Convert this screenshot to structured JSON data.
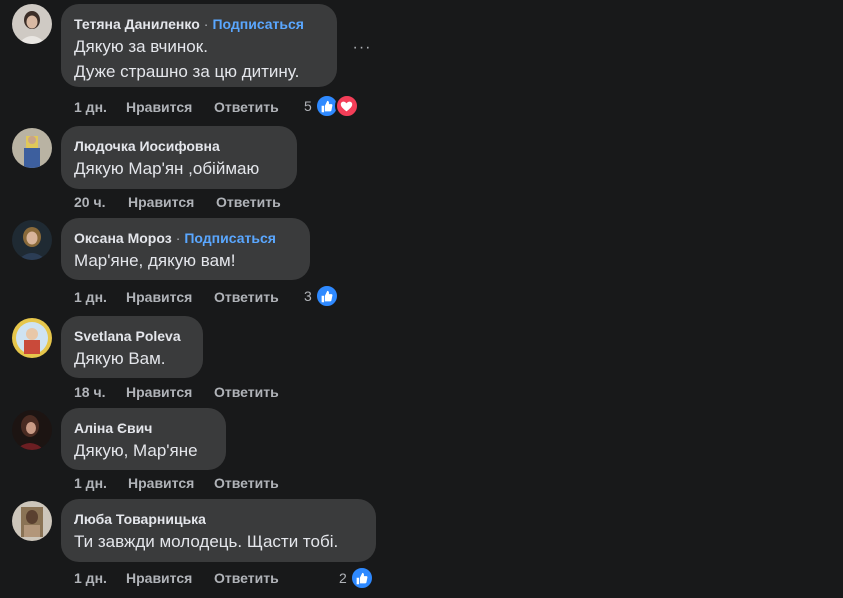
{
  "comments": [
    {
      "author": "Тетяна Даниленко",
      "follow": "Подписаться",
      "lines": [
        "Дякую за вчинок.",
        "Дуже страшно за цю дитину."
      ],
      "time": "1 дн.",
      "like": "Нравится",
      "reply": "Ответить",
      "reaction_count": "5",
      "reactions": [
        "like-icon",
        "love-icon"
      ],
      "more_label": "···"
    },
    {
      "author": "Людочка Иосифовна",
      "lines": [
        "Дякую Мар'ян ,обіймаю"
      ],
      "time": "20 ч.",
      "like": "Нравится",
      "reply": "Ответить"
    },
    {
      "author": "Оксана Мороз",
      "follow": "Подписаться",
      "lines": [
        "Мар'яне, дякую вам!"
      ],
      "time": "1 дн.",
      "like": "Нравится",
      "reply": "Ответить",
      "reaction_count": "3",
      "reactions": [
        "like-icon"
      ]
    },
    {
      "author": "Svetlana Poleva",
      "lines": [
        "Дякую Вам."
      ],
      "time": "18 ч.",
      "like": "Нравится",
      "reply": "Ответить"
    },
    {
      "author": "Аліна Євич",
      "lines": [
        "Дякую, Мар'яне"
      ],
      "time": "1 дн.",
      "like": "Нравится",
      "reply": "Ответить"
    },
    {
      "author": "Люба Товарницька",
      "lines": [
        "Ти завжди молодець. Щасти тобі."
      ],
      "time": "1 дн.",
      "like": "Нравится",
      "reply": "Ответить",
      "reaction_count": "2",
      "reactions": [
        "like-icon"
      ]
    }
  ],
  "colors": {
    "background": "#18191a",
    "bubble": "#3a3b3c",
    "text": "#e4e6eb",
    "secondary": "#b0b3b8",
    "link": "#5aa7ff",
    "like_reaction": "#2e89ff",
    "love_reaction": "#f33e58"
  }
}
